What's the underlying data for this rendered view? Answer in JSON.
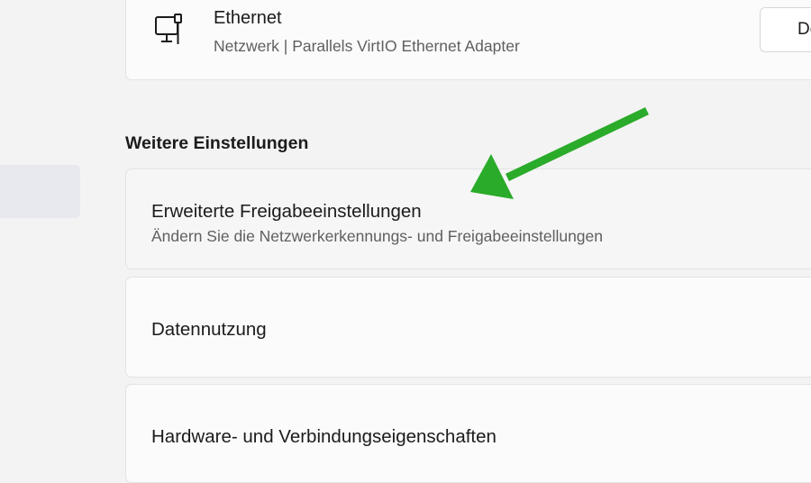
{
  "ethernet": {
    "title": "Ethernet",
    "subtitle": "Netzwerk | Parallels VirtIO Ethernet Adapter",
    "button_label": "Deaktivieren",
    "icon": "ethernet-monitor-icon"
  },
  "section": {
    "header": "Weitere Einstellungen"
  },
  "items": [
    {
      "title": "Erweiterte Freigabeeinstellungen",
      "subtitle": "Ändern Sie die Netzwerkerkennungs- und Freigabeeinstellungen"
    },
    {
      "title": "Datennutzung"
    },
    {
      "title": "Hardware- und Verbindungseigenschaften"
    }
  ],
  "colors": {
    "background": "#f3f3f3",
    "card": "#fbfbfb",
    "arrow": "#2aab2a"
  }
}
